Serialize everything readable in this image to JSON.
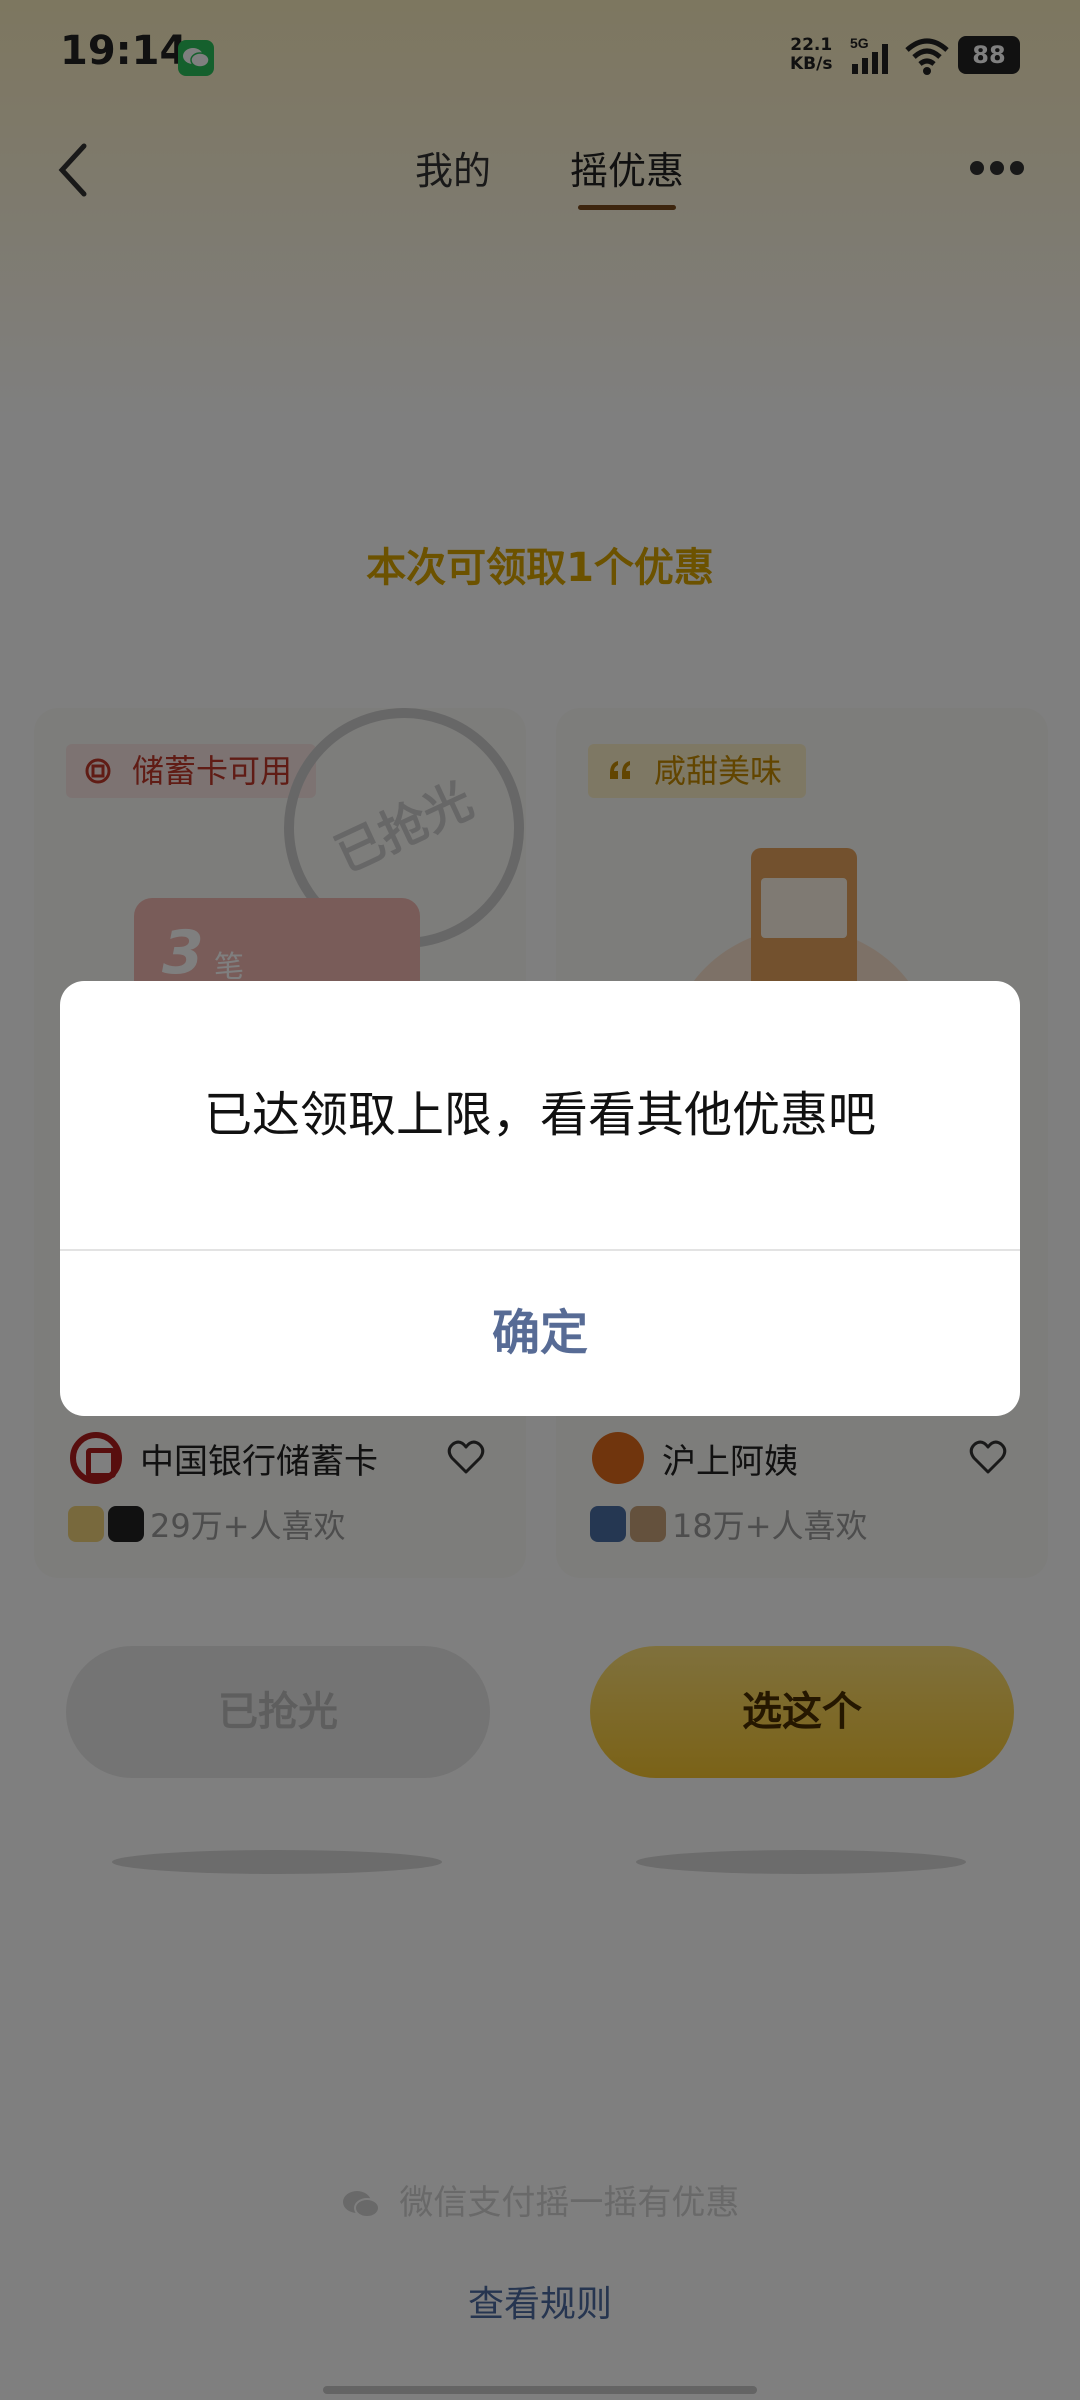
{
  "status_bar": {
    "time": "19:14",
    "net_speed_value": "22.1",
    "net_speed_unit": "KB/s",
    "network": "5G",
    "battery": "88"
  },
  "nav": {
    "tab_mine": "我的",
    "tab_shake": "摇优惠",
    "active_tab": "摇优惠"
  },
  "headline": "本次可领取1个优惠",
  "cards": [
    {
      "tag": "储蓄卡可用",
      "stamp": "已抢光",
      "coupon_num": "3",
      "coupon_unit": "笔",
      "brand": "中国银行储蓄卡",
      "likes": "29万+人喜欢"
    },
    {
      "tag": "咸甜美味",
      "brand": "沪上阿姨",
      "likes": "18万+人喜欢"
    }
  ],
  "buttons": {
    "sold_out": "已抢光",
    "choose": "选这个"
  },
  "footer": {
    "brand": "微信支付摇一摇有优惠",
    "rules": "查看规则"
  },
  "dialog": {
    "message": "已达领取上限，看看其他优惠吧",
    "confirm": "确定"
  },
  "colors": {
    "accent_gold": "#d9a400",
    "link_blue": "#576b95",
    "boc_red": "#b01c1c"
  }
}
